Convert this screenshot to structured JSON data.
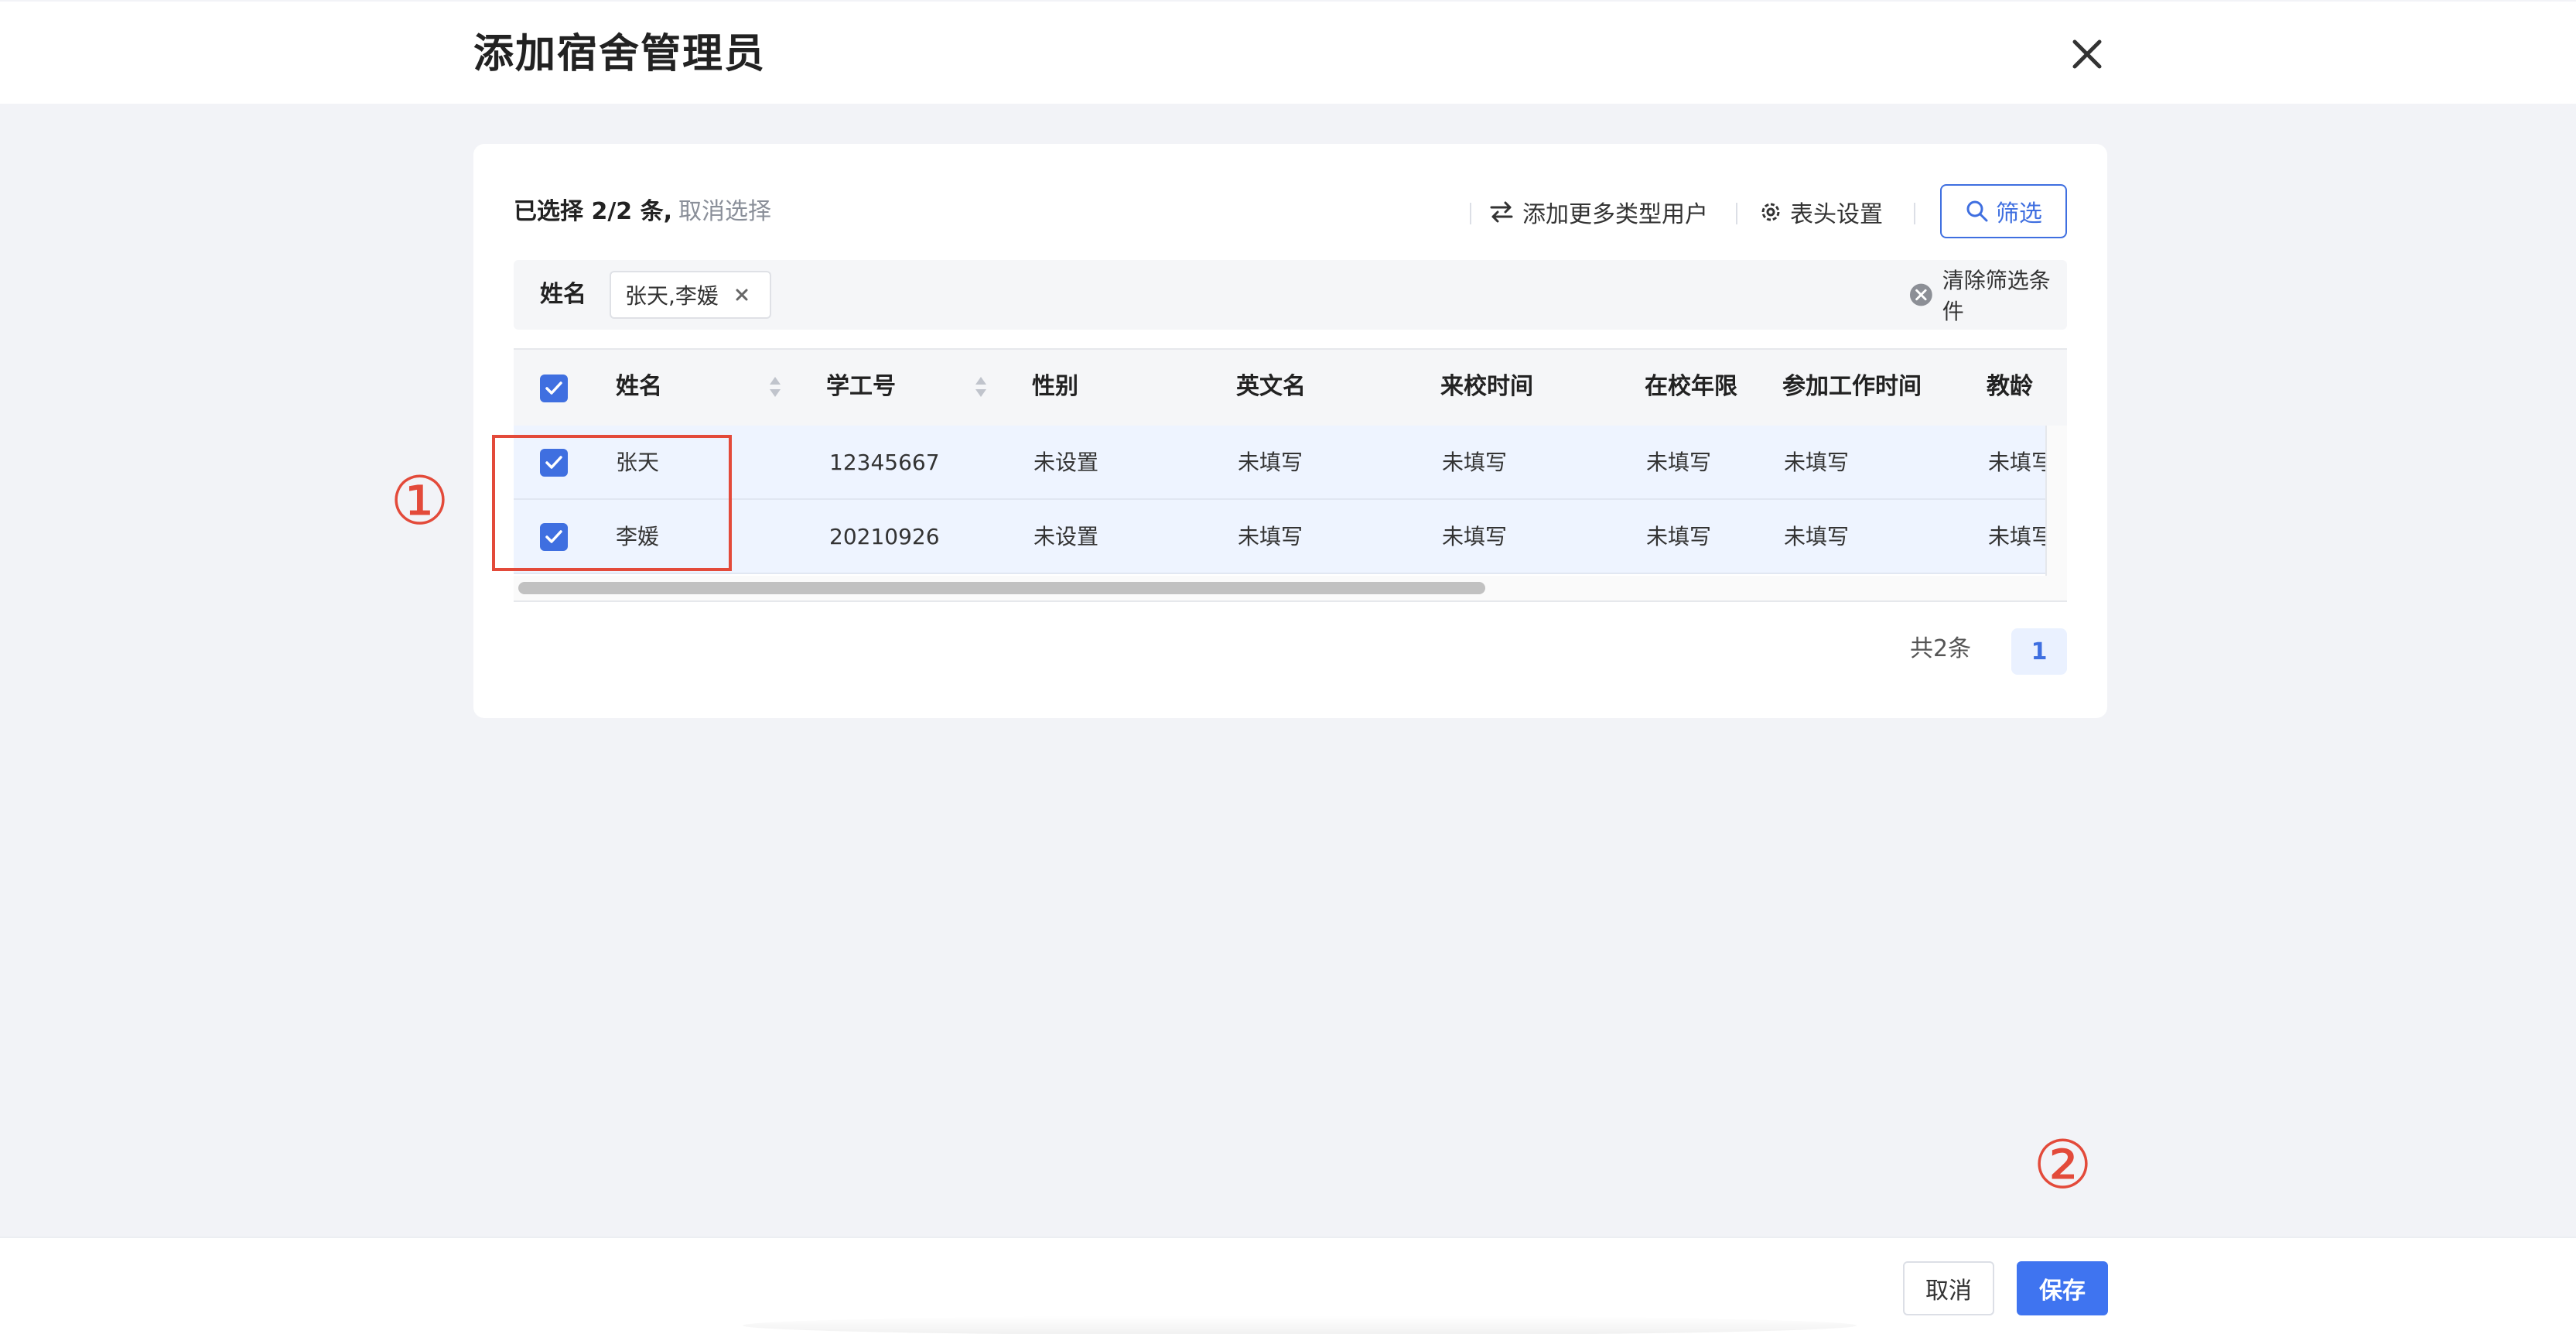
{
  "dialog": {
    "title": "添加宿舍管理员"
  },
  "selection": {
    "summary": "已选择 2/2 条,",
    "cancel_label": "取消选择"
  },
  "toolbar": {
    "add_users_label": "添加更多类型用户",
    "columns_label": "表头设置",
    "filter_label": "筛选"
  },
  "filter_bar": {
    "field_label": "姓名",
    "tag_value": "张天,李媛",
    "clear_label": "清除筛选条件"
  },
  "table": {
    "columns": [
      "姓名",
      "学工号",
      "性别",
      "英文名",
      "来校时间",
      "在校年限",
      "参加工作时间",
      "教龄"
    ],
    "rows": [
      [
        "张天",
        "12345667",
        "未设置",
        "未填写",
        "未填写",
        "未填写",
        "未填写",
        "未填写"
      ],
      [
        "李媛",
        "20210926",
        "未设置",
        "未填写",
        "未填写",
        "未填写",
        "未填写",
        "未填写"
      ]
    ]
  },
  "pagination": {
    "total_label": "共2条",
    "current_page": "1"
  },
  "annotations": {
    "step1": "①",
    "step2": "②"
  },
  "footer": {
    "cancel_label": "取消",
    "save_label": "保存"
  },
  "colors": {
    "primary": "#3f74f0",
    "annotation": "#e34a3a",
    "selected_row": "#eef4ff"
  }
}
